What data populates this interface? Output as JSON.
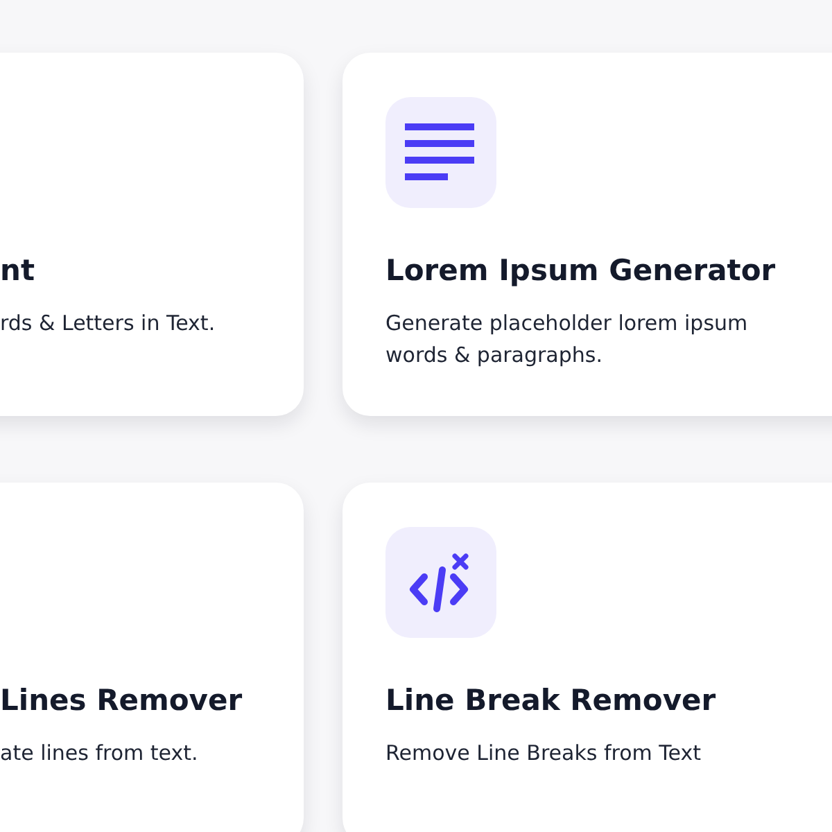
{
  "cards": [
    {
      "title": "nt",
      "description": "rds & Letters in Text."
    },
    {
      "kind": "lines",
      "title": "Lorem Ipsum Generator",
      "description": "Generate placeholder lorem ipsum words & paragraphs."
    },
    {
      "title": "Lines Remover",
      "description": "ate lines from text."
    },
    {
      "kind": "code",
      "title": "Line Break Remover",
      "description": "Remove Line Breaks from Text"
    }
  ]
}
